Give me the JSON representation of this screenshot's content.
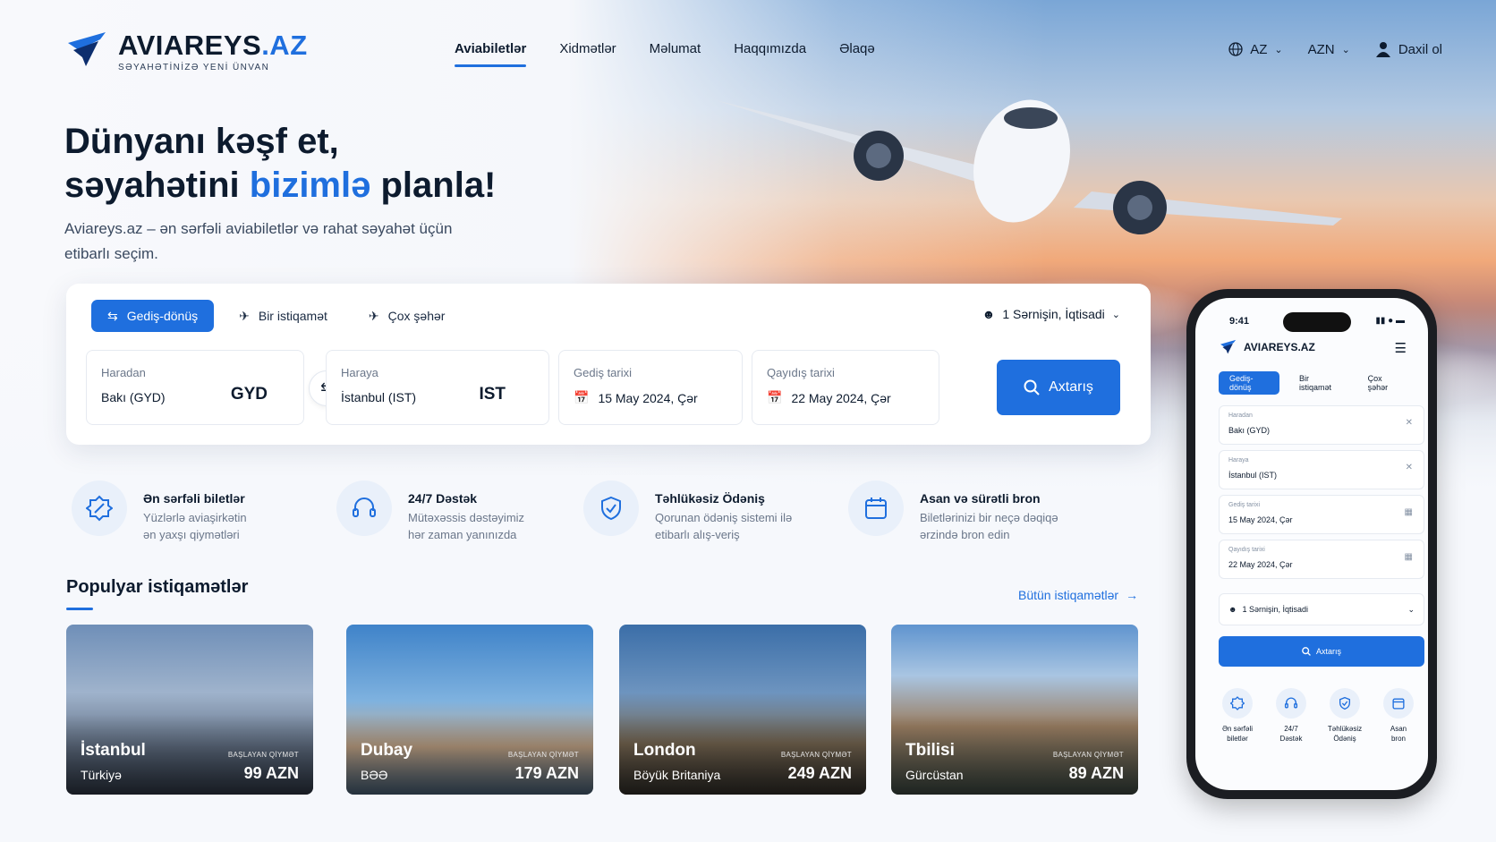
{
  "header": {
    "brand_main": "AVIAREYS",
    "brand_domain": ".AZ",
    "tagline": "SƏYAHƏTİNİZƏ YENİ ÜNVAN",
    "nav": [
      {
        "label": "Aviabiletlər",
        "active": true
      },
      {
        "label": "Xidmətlər",
        "active": false
      },
      {
        "label": "Məlumat",
        "active": false
      },
      {
        "label": "Haqqımızda",
        "active": false
      },
      {
        "label": "Əlaqə",
        "active": false
      }
    ],
    "language": "AZ",
    "currency": "AZN",
    "login": "Daxil ol"
  },
  "hero": {
    "line1": "Dünyanı kəşf et,",
    "line2_pre": "səyahətini ",
    "line2_highlight": "bizimlə",
    "line2_post": " planla!",
    "subtitle": "Aviareys.az – ən sərfəli aviabiletlər və rahat səyahət üçün etibarlı seçim."
  },
  "search": {
    "tabs": [
      {
        "label": "Gediş-dönüş",
        "icon": "swap-icon",
        "active": true
      },
      {
        "label": "Bir istiqamət",
        "icon": "plane-icon",
        "active": false
      },
      {
        "label": "Çox şəhər",
        "icon": "multi-plane-icon",
        "active": false
      }
    ],
    "passengers": "1 Sərnişin, İqtisadi",
    "from_label": "Haradan",
    "from_value": "Bakı (GYD)",
    "from_code": "GYD",
    "to_label": "Haraya",
    "to_value": "İstanbul (IST)",
    "to_code": "IST",
    "depart_label": "Gediş tarixi",
    "depart_value": "15 May 2024, Çər",
    "return_label": "Qayıdış tarixi",
    "return_value": "22 May 2024, Çər",
    "button": "Axtarış"
  },
  "features": [
    {
      "icon": "discount-badge-icon",
      "title": "Ən sərfəli biletlər",
      "desc1": "Yüzlərlə aviaşirkətin",
      "desc2": "ən yaxşı qiymətləri"
    },
    {
      "icon": "headset-icon",
      "title": "24/7 Dəstək",
      "desc1": "Mütəxəssis dəstəyimiz",
      "desc2": "hər zaman yanınızda"
    },
    {
      "icon": "shield-check-icon",
      "title": "Təhlükəsiz Ödəniş",
      "desc1": "Qorunan ödəniş sistemi ilə",
      "desc2": "etibarlı alış-veriş"
    },
    {
      "icon": "calendar-icon",
      "title": "Asan və sürətli bron",
      "desc1": "Biletlərinizi bir neçə dəqiqə",
      "desc2": "ərzində bron edin"
    }
  ],
  "popular": {
    "title": "Populyar istiqamətlər",
    "all_link": "Bütün istiqamətlər",
    "from_label": "BAŞLAYAN QİYMƏT",
    "items": [
      {
        "city": "İstanbul",
        "country": "Türkiyə",
        "price": "99 AZN"
      },
      {
        "city": "Dubay",
        "country": "BƏƏ",
        "price": "179 AZN"
      },
      {
        "city": "London",
        "country": "Böyük Britaniya",
        "price": "249 AZN"
      },
      {
        "city": "Tbilisi",
        "country": "Gürcüstan",
        "price": "89 AZN"
      }
    ]
  },
  "phone": {
    "time": "9:41",
    "brand": "AVIAREYS.AZ",
    "tabs": [
      "Gediş-dönüş",
      "Bir istiqamət",
      "Çox şəhər"
    ],
    "from_label": "Haradan",
    "from_value": "Bakı (GYD)",
    "to_label": "Haraya",
    "to_value": "İstanbul (IST)",
    "depart_label": "Gediş tarixi",
    "depart_value": "15 May 2024, Çər",
    "return_label": "Qayıdış tarixi",
    "return_value": "22 May 2024, Çər",
    "passengers": "1 Sərnişin, İqtisadi",
    "button": "Axtarış",
    "features": [
      {
        "l1": "Ən sərfəli",
        "l2": "biletlər"
      },
      {
        "l1": "24/7",
        "l2": "Dəstək"
      },
      {
        "l1": "Təhlükəsiz",
        "l2": "Ödəniş"
      },
      {
        "l1": "Asan",
        "l2": "bron"
      }
    ]
  },
  "colors": {
    "accent": "#1f6fde",
    "text": "#0d1b2e",
    "muted": "#6b778a"
  }
}
